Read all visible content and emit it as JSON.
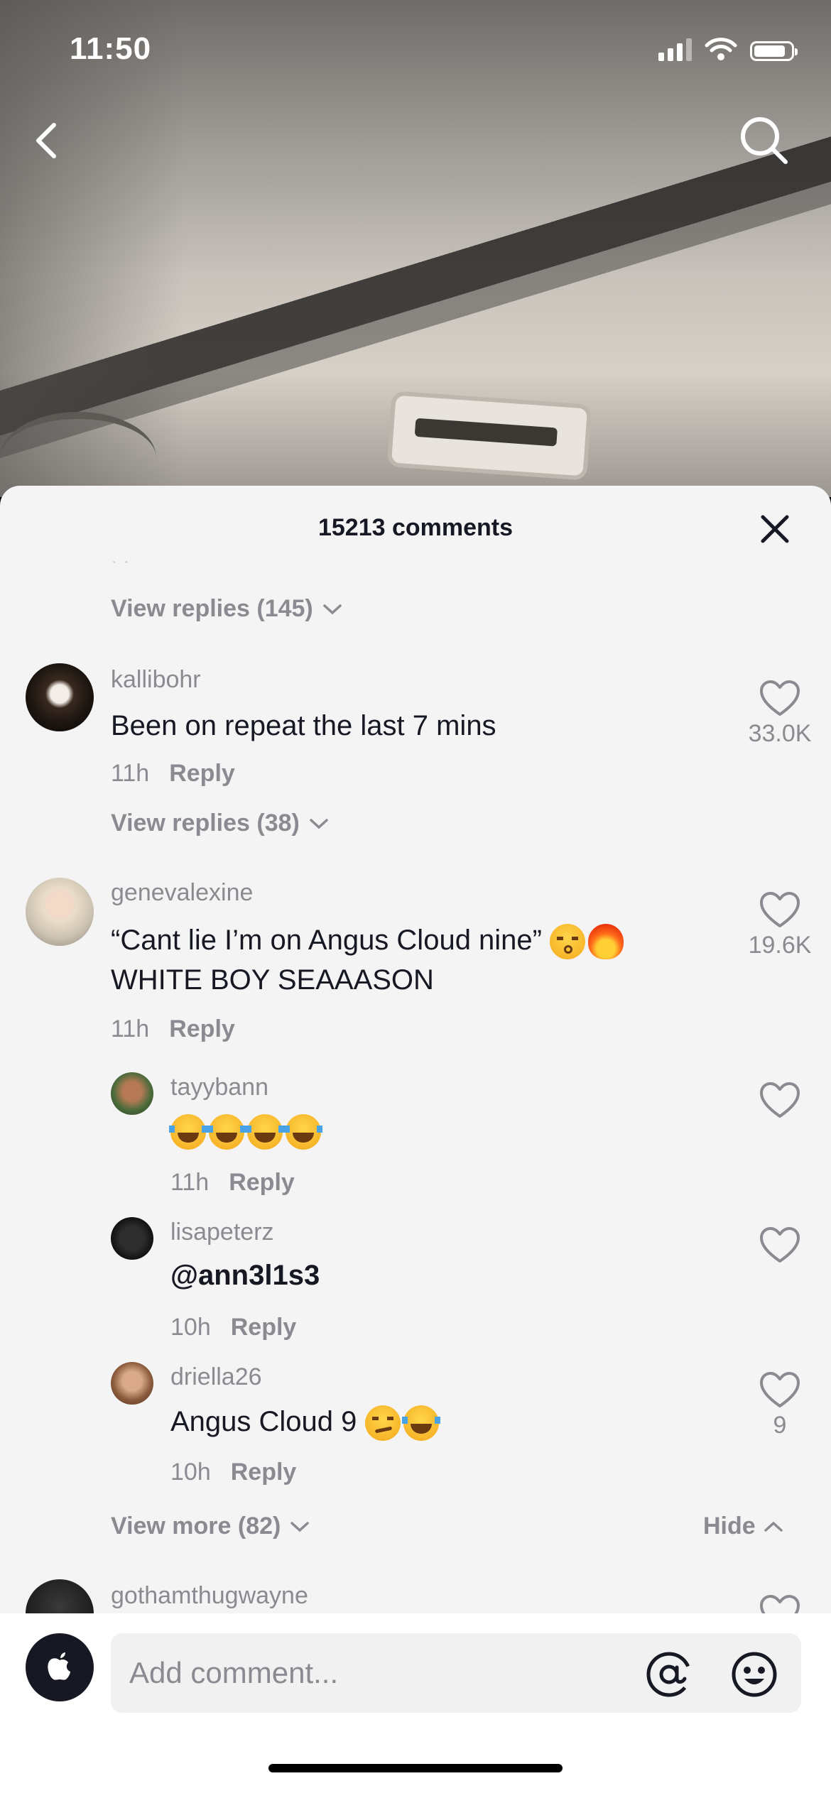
{
  "status_bar": {
    "time": "11:50"
  },
  "sheet": {
    "title": "15213 comments",
    "faded_text": "· ·",
    "view_replies_top": "View replies (145)"
  },
  "comments": [
    {
      "username": "kallibohr",
      "text": "Been on repeat the last 7 mins",
      "time": "11h",
      "reply_label": "Reply",
      "likes": "33.0K",
      "view_replies": "View replies (38)"
    },
    {
      "username": "genevalexine",
      "text_line1": "“Cant lie I’m on Angus Cloud nine”",
      "text_line2": "WHITE BOY SEAAASON",
      "time": "11h",
      "reply_label": "Reply",
      "likes": "19.6K",
      "replies": [
        {
          "username": "tayybann",
          "time": "11h",
          "reply_label": "Reply"
        },
        {
          "username": "lisapeterz",
          "text": "@ann3l1s3",
          "time": "10h",
          "reply_label": "Reply"
        },
        {
          "username": "driella26",
          "text": "Angus Cloud 9",
          "time": "10h",
          "reply_label": "Reply",
          "likes": "9"
        }
      ],
      "view_more": "View more (82)",
      "hide_label": "Hide"
    },
    {
      "username": "gothamthugwayne"
    }
  ],
  "input": {
    "placeholder": "Add comment..."
  },
  "colors": {
    "sheet_bg": "#f4f4f4",
    "muted": "#8a8b91",
    "text": "#161823"
  }
}
